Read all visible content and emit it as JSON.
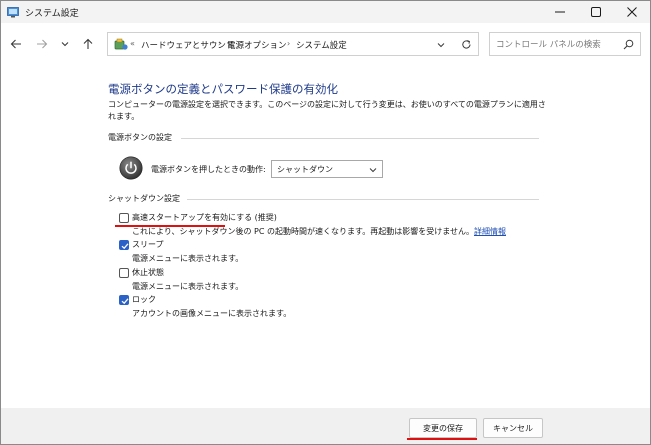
{
  "window": {
    "title": "システム設定"
  },
  "address": {
    "overflow": "«",
    "crumbs": [
      "ハードウェアとサウンド",
      "電源オプション",
      "システム設定"
    ]
  },
  "search": {
    "placeholder": "コントロール パネルの検索"
  },
  "page": {
    "title": "電源ボタンの定義とパスワード保護の有効化",
    "description": "コンピューターの電源設定を選択できます。このページの設定に対して行う変更は、お使いのすべての電源プランに適用されます。"
  },
  "power_buttons": {
    "group_label": "電源ボタンの設定",
    "action_label": "電源ボタンを押したときの動作:",
    "action_value": "シャットダウン"
  },
  "shutdown": {
    "group_label": "シャットダウン設定",
    "items": [
      {
        "label": "高速スタートアップを有効にする (推奨)",
        "checked": false,
        "description": "これにより、シャットダウン後の PC の起動時間が速くなります。再起動は影響を受けません。",
        "link": "詳細情報"
      },
      {
        "label": "スリープ",
        "checked": true,
        "description": "電源メニューに表示されます。"
      },
      {
        "label": "休止状態",
        "checked": false,
        "description": "電源メニューに表示されます。"
      },
      {
        "label": "ロック",
        "checked": true,
        "description": "アカウントの画像メニューに表示されます。"
      }
    ]
  },
  "buttons": {
    "save": "変更の保存",
    "cancel": "キャンセル"
  },
  "colors": {
    "accent": "#2b62c7",
    "title": "#1e3a8a",
    "annotation": "#e01010",
    "link": "#1f4fb4"
  },
  "icons": [
    "control-panel-icon",
    "minimize-icon",
    "maximize-icon",
    "close-icon",
    "back-arrow-icon",
    "forward-arrow-icon",
    "recent-locations-icon",
    "up-arrow-icon",
    "power-options-icon",
    "chevron-down-icon",
    "refresh-icon",
    "search-icon",
    "power-button-icon",
    "checkmark-icon"
  ]
}
